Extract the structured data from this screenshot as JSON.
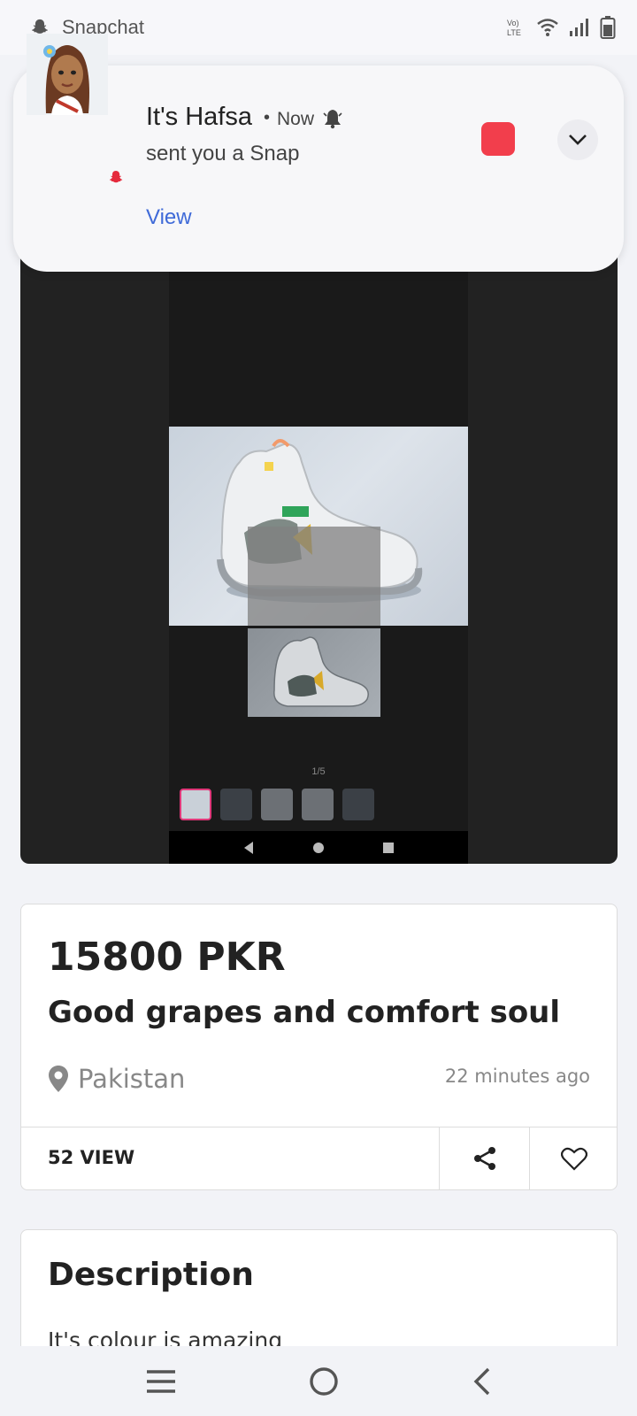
{
  "status_bar": {
    "app_name": "Snapchat",
    "icons": [
      "snapchat-ghost-icon",
      "volte-icon",
      "wifi-icon",
      "signal-icon",
      "battery-icon"
    ]
  },
  "notification": {
    "sender": "It's Hafsa",
    "separator": "•",
    "time": "Now",
    "message": "sent you a Snap",
    "action_label": "View",
    "accent_color": "#f23e4c"
  },
  "viewer": {
    "counter": "1/5",
    "thumbnail_count": 5
  },
  "listing": {
    "price": "15800 PKR",
    "title": "Good grapes and comfort soul",
    "location": "Pakistan",
    "posted": "22 minutes ago",
    "views": "52 VIEW"
  },
  "description": {
    "heading": "Description",
    "text": "It's colour is amazing"
  },
  "colors": {
    "link_blue": "#3f6ad8",
    "selected_thumb": "#e0397a"
  }
}
